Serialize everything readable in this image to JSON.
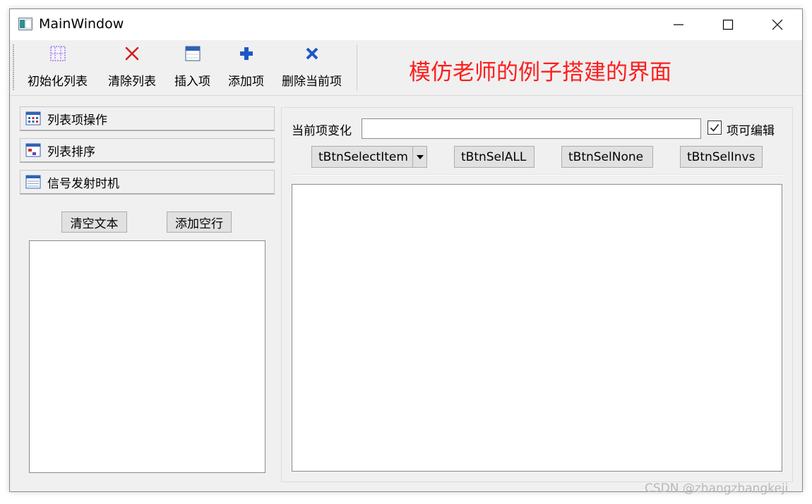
{
  "window": {
    "title": "MainWindow"
  },
  "toolbar": {
    "items": [
      {
        "label": "初始化列表",
        "icon": "grid-list-icon"
      },
      {
        "label": "清除列表",
        "icon": "red-x-icon"
      },
      {
        "label": "插入项",
        "icon": "insert-row-icon"
      },
      {
        "label": "添加项",
        "icon": "blue-plus-icon"
      },
      {
        "label": "删除当前项",
        "icon": "blue-x-icon"
      }
    ],
    "banner": "模仿老师的例子搭建的界面",
    "banner_color": "#ff1d1d"
  },
  "toolbox": {
    "pages": [
      {
        "label": "列表项操作",
        "icon": "table-icon"
      },
      {
        "label": "列表排序",
        "icon": "sort-window-icon"
      },
      {
        "label": "信号发射时机",
        "icon": "calendar-icon"
      }
    ],
    "clear_text": "清空文本",
    "add_empty_line": "添加空行"
  },
  "main": {
    "current_change_label": "当前项变化",
    "current_change_value": "",
    "editable_label": "项可编辑",
    "editable_checked": true,
    "buttons": {
      "select_item": "tBtnSelectItem",
      "select_all": "tBtnSelALL",
      "select_none": "tBtnSelNone",
      "select_invert": "tBtnSelInvs"
    }
  },
  "watermark": "CSDN @zhangzhangkeji"
}
